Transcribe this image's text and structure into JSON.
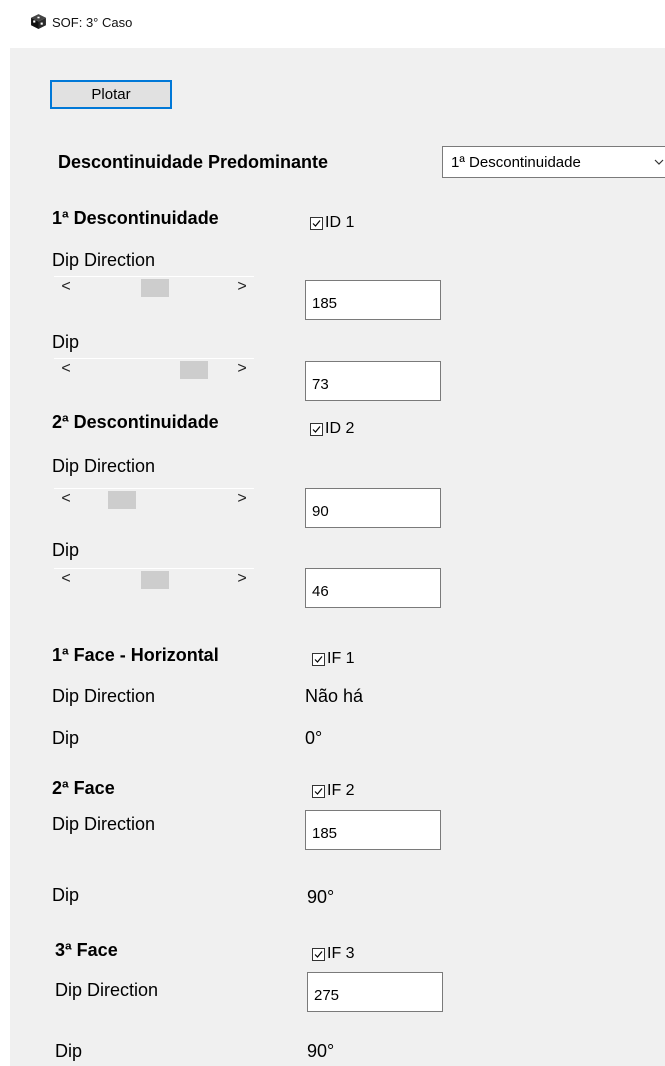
{
  "window": {
    "title": "SOF: 3° Caso",
    "icon": "app-cube-icon"
  },
  "toolbar": {
    "plot_label": "Plotar"
  },
  "predominante": {
    "label": "Descontinuidade Predominante",
    "selected": "1ª Descontinuidade"
  },
  "d1": {
    "heading": "1ª Descontinuidade",
    "checkbox_label": "ID 1",
    "checked": true,
    "dipdir_label": "Dip Direction",
    "dipdir_value": "185",
    "dipdir_slider": 0.51,
    "dip_label": "Dip",
    "dip_value": "73",
    "dip_slider": 0.81
  },
  "d2": {
    "heading": "2ª Descontinuidade",
    "checkbox_label": "ID 2",
    "checked": true,
    "dipdir_label": "Dip Direction",
    "dipdir_value": "90",
    "dipdir_slider": 0.25,
    "dip_label": "Dip",
    "dip_value": "46",
    "dip_slider": 0.51
  },
  "f1": {
    "heading": "1ª Face - Horizontal",
    "checkbox_label": "IF 1",
    "checked": true,
    "dipdir_label": "Dip Direction",
    "dipdir_value": "Não há",
    "dip_label": "Dip",
    "dip_value": "0°"
  },
  "f2": {
    "heading": "2ª Face",
    "checkbox_label": "IF 2",
    "checked": true,
    "dipdir_label": "Dip Direction",
    "dipdir_value": "185",
    "dip_label": "Dip",
    "dip_value": "90°"
  },
  "f3": {
    "heading": "3ª Face",
    "checkbox_label": "IF 3",
    "checked": true,
    "dipdir_label": "Dip Direction",
    "dipdir_value": "275",
    "dip_label": "Dip",
    "dip_value": "90°"
  },
  "scroll": {
    "left_arrow": "<",
    "right_arrow": ">"
  }
}
